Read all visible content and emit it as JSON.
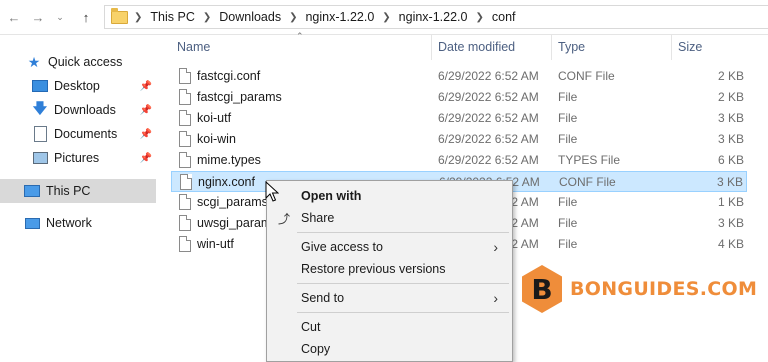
{
  "address": {
    "crumbs": [
      "This PC",
      "Downloads",
      "nginx-1.22.0",
      "nginx-1.22.0",
      "conf"
    ]
  },
  "nav": {
    "quick_access": "Quick access",
    "desktop": "Desktop",
    "downloads": "Downloads",
    "documents": "Documents",
    "pictures": "Pictures",
    "this_pc": "This PC",
    "network": "Network"
  },
  "columns": {
    "name": "Name",
    "date": "Date modified",
    "type": "Type",
    "size": "Size"
  },
  "files": [
    {
      "name": "fastcgi.conf",
      "date": "6/29/2022 6:52 AM",
      "type": "CONF File",
      "size": "2 KB"
    },
    {
      "name": "fastcgi_params",
      "date": "6/29/2022 6:52 AM",
      "type": "File",
      "size": "2 KB"
    },
    {
      "name": "koi-utf",
      "date": "6/29/2022 6:52 AM",
      "type": "File",
      "size": "3 KB"
    },
    {
      "name": "koi-win",
      "date": "6/29/2022 6:52 AM",
      "type": "File",
      "size": "3 KB"
    },
    {
      "name": "mime.types",
      "date": "6/29/2022 6:52 AM",
      "type": "TYPES File",
      "size": "6 KB"
    },
    {
      "name": "nginx.conf",
      "date": "6/29/2022 6:52 AM",
      "type": "CONF File",
      "size": "3 KB"
    },
    {
      "name": "scgi_params",
      "date": "6/29/2022 6:52 AM",
      "type": "File",
      "size": "1 KB"
    },
    {
      "name": "uwsgi_params",
      "date": "6/29/2022 6:52 AM",
      "type": "File",
      "size": "3 KB"
    },
    {
      "name": "win-utf",
      "date": "6/29/2022 6:52 AM",
      "type": "File",
      "size": "4 KB"
    }
  ],
  "context_menu": {
    "open_with": "Open with",
    "share": "Share",
    "give_access": "Give access to",
    "restore": "Restore previous versions",
    "send_to": "Send to",
    "cut": "Cut",
    "copy": "Copy"
  },
  "watermark": {
    "letter": "B",
    "text": "BONGUIDES.COM",
    "color": "#ef8d3a"
  },
  "colors": {
    "selection": "#cce8ff",
    "selection_border": "#99d1ff",
    "header_text": "#4d6082",
    "nav_selected": "#d9d9d9"
  }
}
